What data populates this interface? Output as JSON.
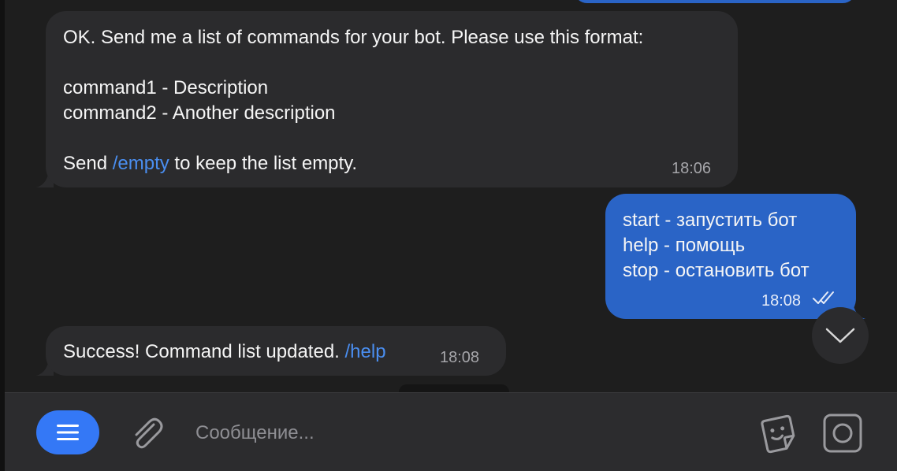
{
  "chat": {
    "msg1": {
      "line1": "OK. Send me a list of commands for your bot. Please use this format:",
      "line2": "command1 - Description",
      "line3": "command2 - Another description",
      "line4_prefix": "Send ",
      "line4_link": "/empty",
      "line4_suffix": " to keep the list empty.",
      "time": "18:06"
    },
    "msg2": {
      "line1": "start - запустить бот",
      "line2": "help - помощь",
      "line3": "stop - остановить бот",
      "time": "18:08",
      "status_icon": "double-check-icon"
    },
    "msg3": {
      "text": "Success! Command list updated. ",
      "link": "/help",
      "time": "18:08"
    }
  },
  "composer": {
    "placeholder": "Сообщение..."
  },
  "colors": {
    "outgoing_bubble": "#2a64c6",
    "incoming_bubble": "#2b2b2d",
    "link": "#4a8ef0",
    "accent": "#3478f6"
  }
}
